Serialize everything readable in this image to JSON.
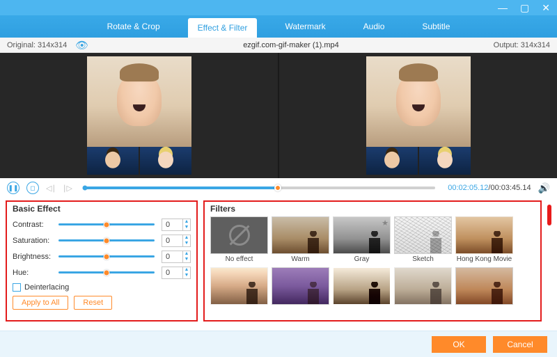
{
  "tabs": [
    "Rotate & Crop",
    "Effect & Filter",
    "Watermark",
    "Audio",
    "Subtitle"
  ],
  "active_tab": 1,
  "info": {
    "original": "Original: 314x314",
    "filename": "ezgif.com-gif-maker (1).mp4",
    "output": "Output: 314x314"
  },
  "playback": {
    "current": "00:02:05.12",
    "total": "/00:03:45.14"
  },
  "basic": {
    "title": "Basic Effect",
    "sliders": [
      {
        "label": "Contrast:",
        "value": "0"
      },
      {
        "label": "Saturation:",
        "value": "0"
      },
      {
        "label": "Brightness:",
        "value": "0"
      },
      {
        "label": "Hue:",
        "value": "0"
      }
    ],
    "deinterlacing": "Deinterlacing",
    "apply_all": "Apply to All",
    "reset": "Reset"
  },
  "filters": {
    "title": "Filters",
    "row1": [
      "No effect",
      "Warm",
      "Gray",
      "Sketch",
      "Hong Kong Movie"
    ],
    "row2": [
      "",
      "",
      "",
      "",
      ""
    ]
  },
  "footer": {
    "ok": "OK",
    "cancel": "Cancel"
  }
}
